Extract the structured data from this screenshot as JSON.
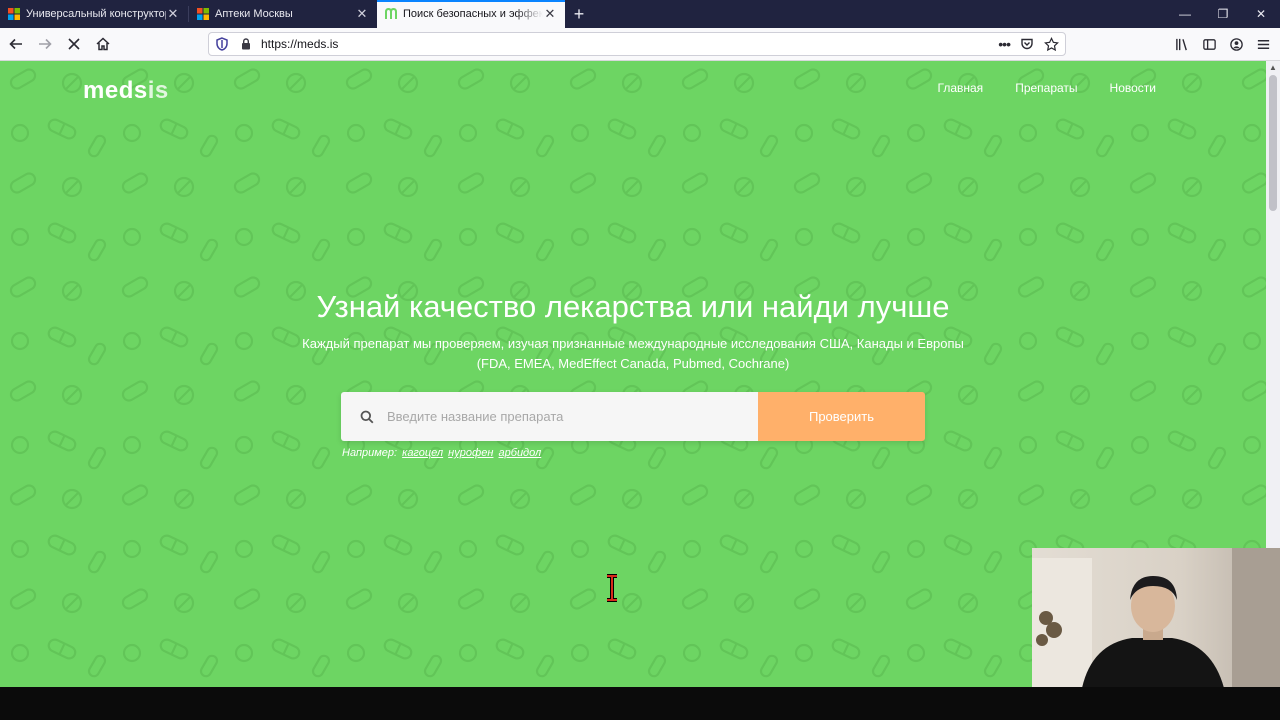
{
  "tabs": [
    {
      "title": "Универсальный конструктор",
      "active": false
    },
    {
      "title": "Аптеки Москвы",
      "active": false
    },
    {
      "title": "Поиск безопасных и эффективных",
      "active": true
    }
  ],
  "toolbar": {
    "url": "https://meds.is"
  },
  "site": {
    "logo_main": "meds",
    "logo_suffix": "is",
    "nav": [
      "Главная",
      "Препараты",
      "Новости"
    ]
  },
  "hero": {
    "title": "Узнай качество лекарства или найди лучше",
    "subtitle_line1": "Каждый препарат мы проверяем, изучая признанные международные исследования США, Канады и Европы",
    "subtitle_line2": "(FDA, EMEA, MedEffect Canada, Pubmed, Cochrane)"
  },
  "search": {
    "placeholder": "Введите название препарата",
    "value": "",
    "button_label": "Проверить"
  },
  "examples": {
    "label": "Например:",
    "items": [
      "кагоцел",
      "нурофен",
      "арбидол"
    ]
  },
  "colors": {
    "page_bg": "#6dd563",
    "button": "#ffb06a",
    "tabstrip": "#202340",
    "accent": "#0a84ff"
  }
}
